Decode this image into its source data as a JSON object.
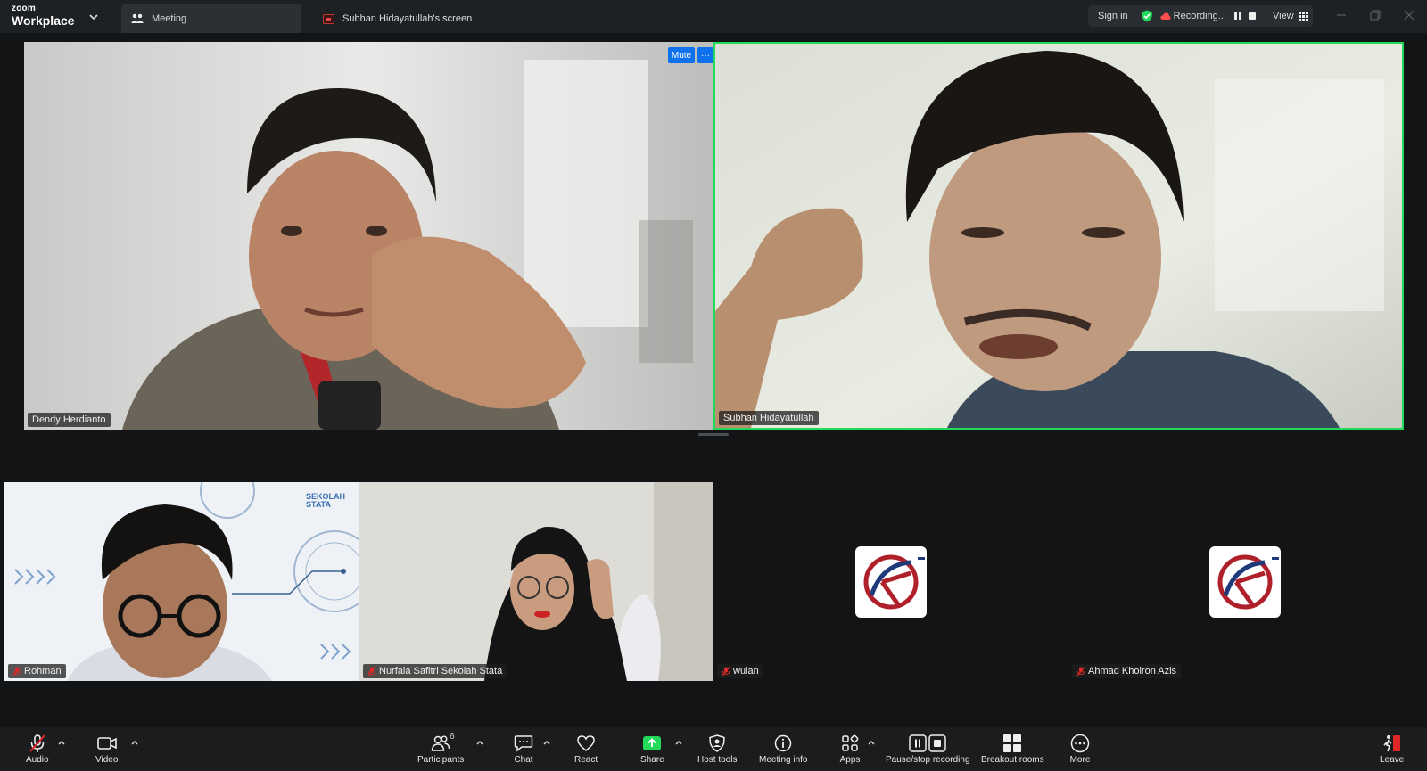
{
  "app": {
    "brand_small": "zoom",
    "brand_big": "Workplace"
  },
  "tabs": [
    {
      "label": "Meeting"
    },
    {
      "label": "Subhan Hidayatullah's screen"
    }
  ],
  "header": {
    "sign_in": "Sign in",
    "recording": "Recording...",
    "view": "View"
  },
  "colors": {
    "accent_blue": "#0e72ed",
    "active_speaker": "#23d959",
    "share_green": "#23d959",
    "muted_red": "#e02828"
  },
  "videos": {
    "dendy": {
      "name": "Dendy Herdianto",
      "mute": "Mute",
      "more": "···"
    },
    "subhan": {
      "name": "Subhan Hidayatullah"
    },
    "rohman": {
      "name": "Rohman"
    },
    "nurfala": {
      "name": "Nurfala Safitri Sekolah Stata",
      "bg_text_1": "SEKOLAH",
      "bg_text_2": "STATA"
    },
    "wulan": {
      "name": "wulan"
    },
    "ahmad": {
      "name": "Ahmad Khoiron Azis"
    }
  },
  "toolbar": {
    "audio": "Audio",
    "video": "Video",
    "participants": "Participants",
    "participants_count": "6",
    "chat": "Chat",
    "react": "React",
    "share": "Share",
    "host_tools": "Host tools",
    "meeting_info": "Meeting info",
    "apps": "Apps",
    "pause_stop": "Pause/stop recording",
    "breakout": "Breakout rooms",
    "more": "More",
    "leave": "Leave"
  }
}
